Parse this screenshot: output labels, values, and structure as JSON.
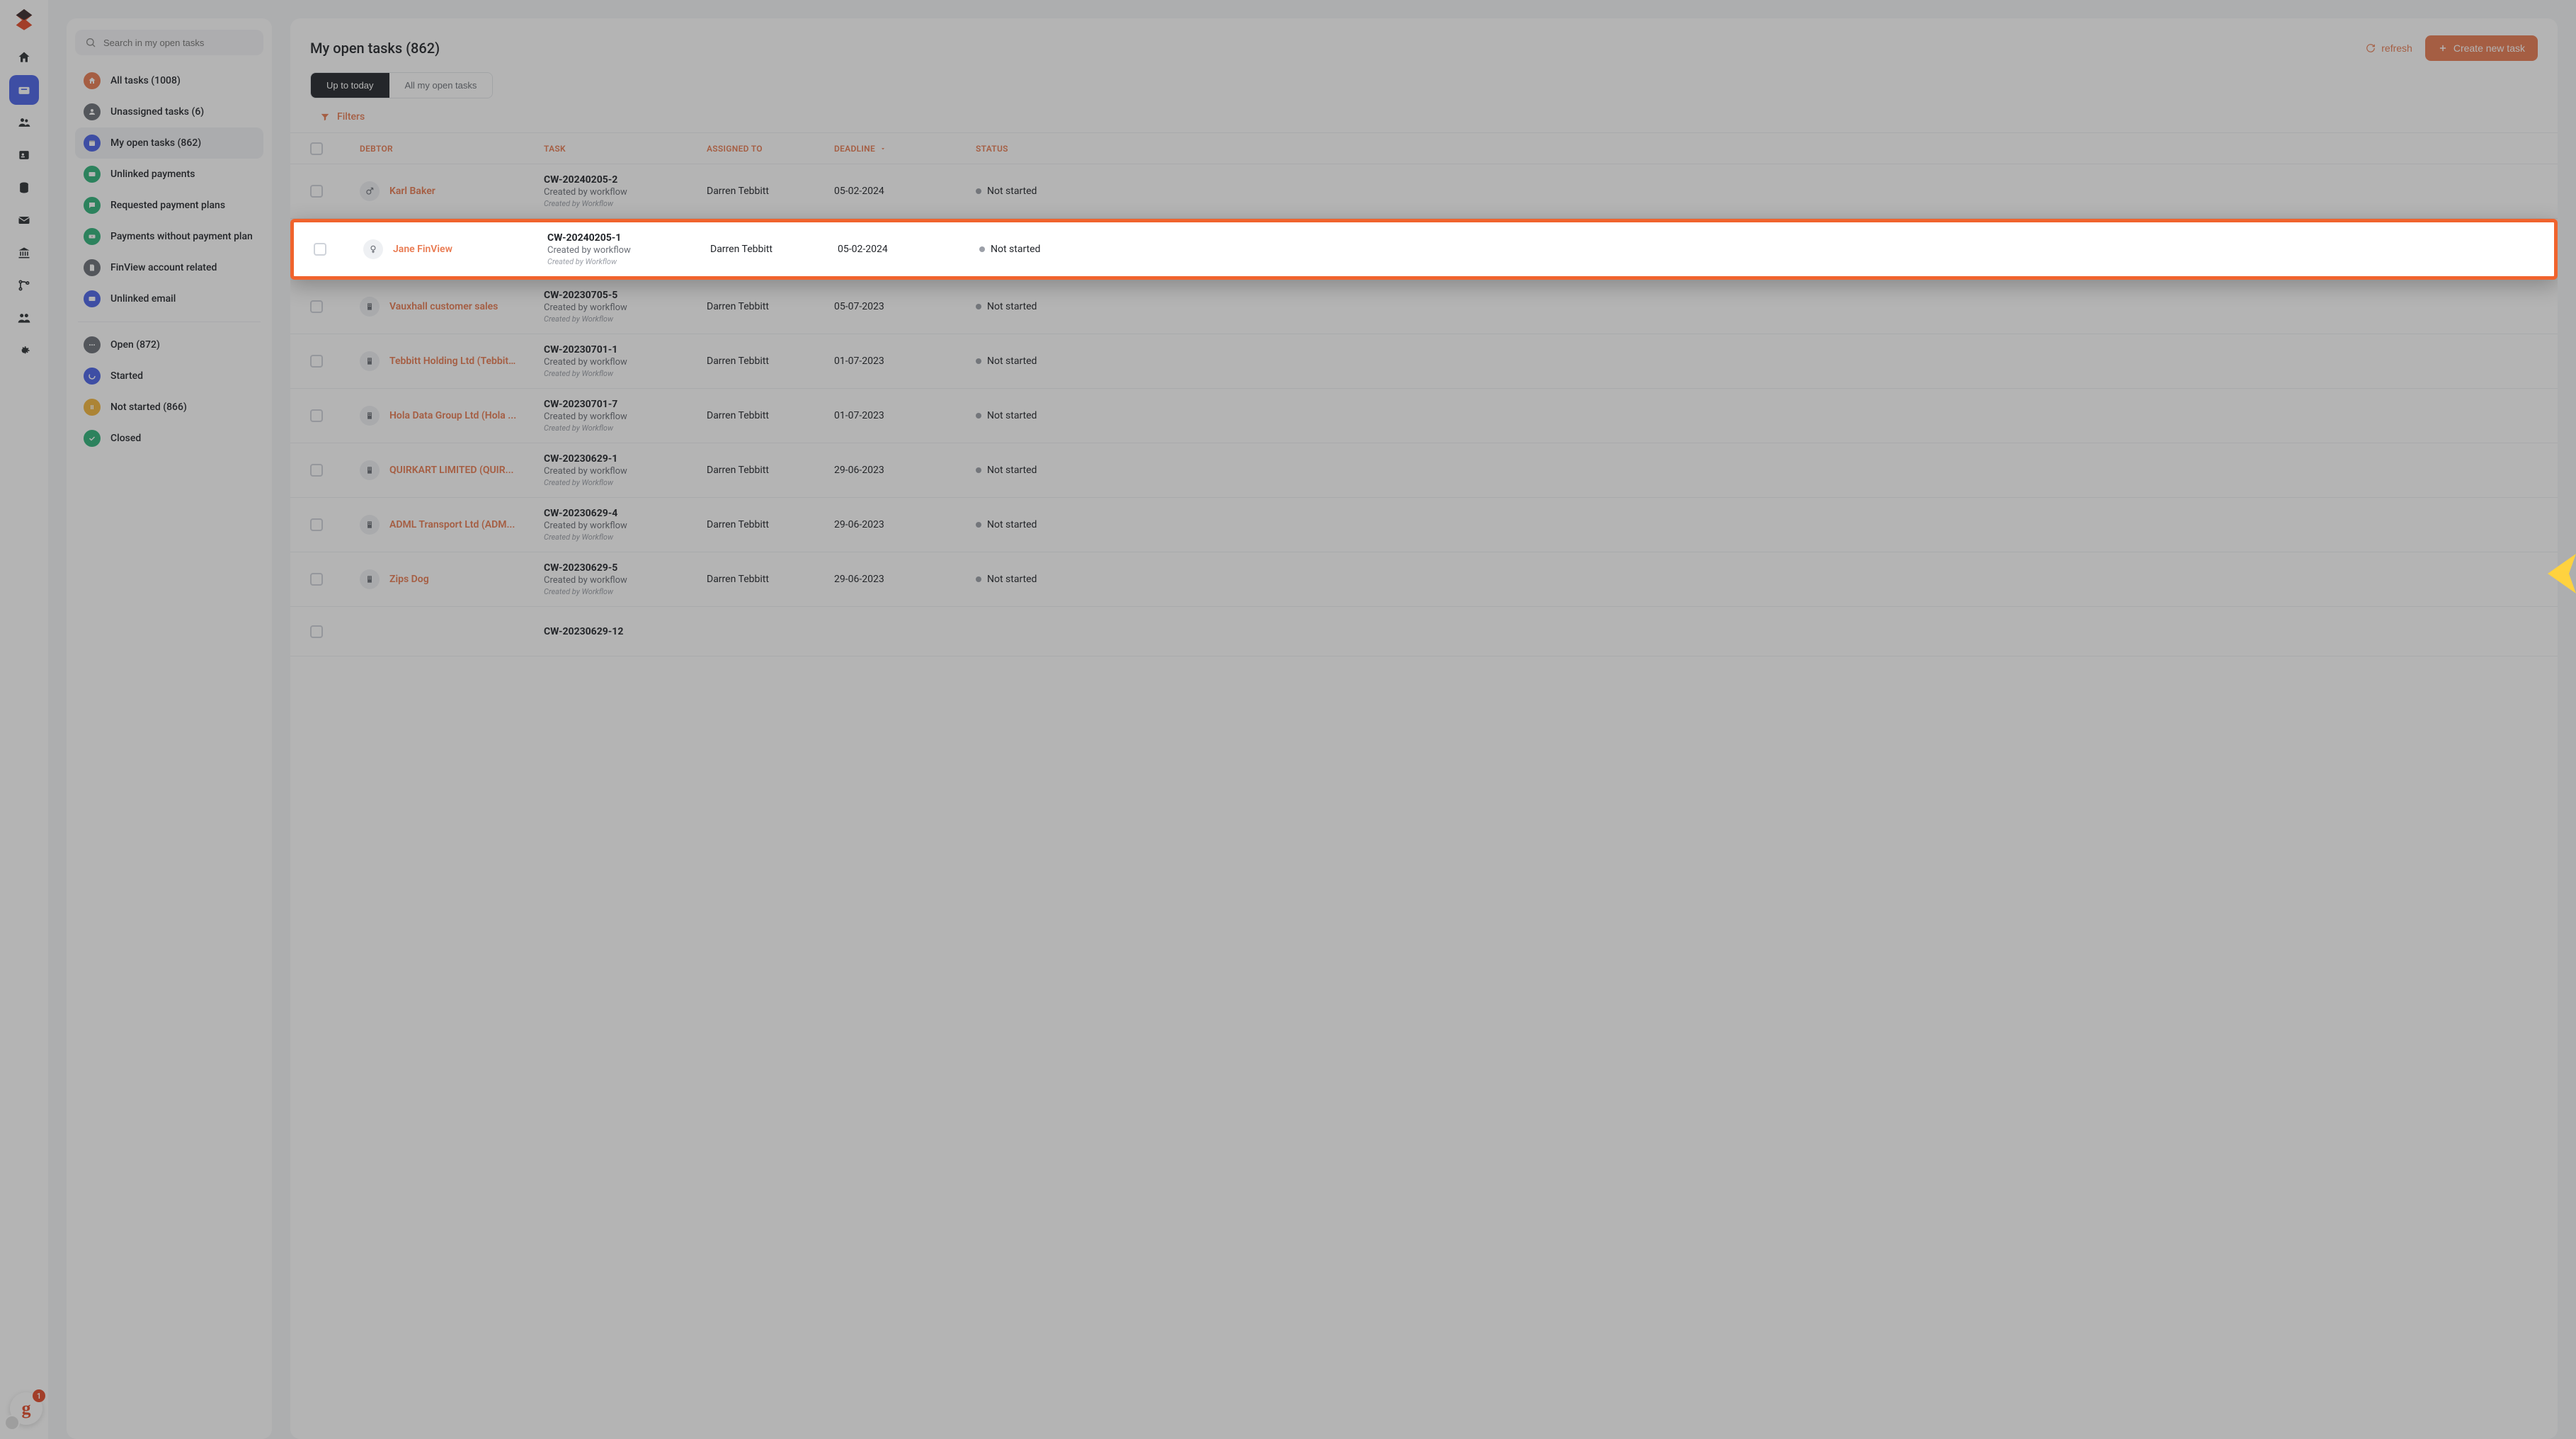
{
  "search": {
    "placeholder": "Search in my open tasks"
  },
  "sidebar": {
    "groups": [
      [
        {
          "label": "All tasks (1008)",
          "color": "#e97b52",
          "icon": "home"
        },
        {
          "label": "Unassigned tasks (6)",
          "color": "#6b6f77",
          "icon": "user"
        },
        {
          "label": "My open tasks (862)",
          "color": "#4b63e6",
          "icon": "calendar",
          "active": true
        },
        {
          "label": "Unlinked payments",
          "color": "#2fb37a",
          "icon": "card"
        },
        {
          "label": "Requested payment plans",
          "color": "#2fb37a",
          "icon": "chat"
        },
        {
          "label": "Payments without payment plan",
          "color": "#2fb37a",
          "icon": "money"
        },
        {
          "label": "FinView account related",
          "color": "#6b6f77",
          "icon": "doc"
        },
        {
          "label": "Unlinked email",
          "color": "#4b63e6",
          "icon": "mail"
        }
      ],
      [
        {
          "label": "Open (872)",
          "color": "#6b6f77",
          "icon": "dots"
        },
        {
          "label": "Started",
          "color": "#4b63e6",
          "icon": "spinner"
        },
        {
          "label": "Not started (866)",
          "color": "#f3b63c",
          "icon": "pause"
        },
        {
          "label": "Closed",
          "color": "#2fb37a",
          "icon": "check"
        }
      ]
    ]
  },
  "header": {
    "title": "My open tasks (862)",
    "refresh": "refresh",
    "create": "Create new task"
  },
  "tabs": {
    "up_to_today": "Up to today",
    "all_open": "All my open tasks"
  },
  "filters_label": "Filters",
  "columns": {
    "debtor": "DEBTOR",
    "task": "TASK",
    "assigned": "ASSIGNED TO",
    "deadline": "DEADLINE",
    "status": "STATUS"
  },
  "rows": [
    {
      "debtor": "Karl Baker",
      "icon": "male",
      "task_id": "CW-20240205-2",
      "sub": "Created by workflow",
      "meta": "Created by Workflow",
      "assigned": "Darren Tebbitt",
      "deadline": "05-02-2024",
      "status": "Not started",
      "highlight": false
    },
    {
      "debtor": "Jane FinView",
      "icon": "female",
      "task_id": "CW-20240205-1",
      "sub": "Created by workflow",
      "meta": "Created by Workflow",
      "assigned": "Darren Tebbitt",
      "deadline": "05-02-2024",
      "status": "Not started",
      "highlight": true
    },
    {
      "debtor": "Vauxhall customer sales",
      "icon": "building",
      "task_id": "CW-20230705-5",
      "sub": "Created by workflow",
      "meta": "Created by Workflow",
      "assigned": "Darren Tebbitt",
      "deadline": "05-07-2023",
      "status": "Not started",
      "highlight": false
    },
    {
      "debtor": "Tebbitt Holding Ltd (Tebbit...",
      "icon": "building",
      "task_id": "CW-20230701-1",
      "sub": "Created by workflow",
      "meta": "Created by Workflow",
      "assigned": "Darren Tebbitt",
      "deadline": "01-07-2023",
      "status": "Not started",
      "highlight": false
    },
    {
      "debtor": "Hola Data Group Ltd (Hola ...",
      "icon": "building",
      "task_id": "CW-20230701-7",
      "sub": "Created by workflow",
      "meta": "Created by Workflow",
      "assigned": "Darren Tebbitt",
      "deadline": "01-07-2023",
      "status": "Not started",
      "highlight": false
    },
    {
      "debtor": "QUIRKART LIMITED (QUIR...",
      "icon": "building",
      "task_id": "CW-20230629-1",
      "sub": "Created by workflow",
      "meta": "Created by Workflow",
      "assigned": "Darren Tebbitt",
      "deadline": "29-06-2023",
      "status": "Not started",
      "highlight": false
    },
    {
      "debtor": "ADML Transport Ltd (ADM...",
      "icon": "building",
      "task_id": "CW-20230629-4",
      "sub": "Created by workflow",
      "meta": "Created by Workflow",
      "assigned": "Darren Tebbitt",
      "deadline": "29-06-2023",
      "status": "Not started",
      "highlight": false
    },
    {
      "debtor": "Zips Dog",
      "icon": "building",
      "task_id": "CW-20230629-5",
      "sub": "Created by workflow",
      "meta": "Created by Workflow",
      "assigned": "Darren Tebbitt",
      "deadline": "29-06-2023",
      "status": "Not started",
      "highlight": false
    },
    {
      "debtor": "",
      "icon": "",
      "task_id": "CW-20230629-12",
      "sub": "",
      "meta": "",
      "assigned": "",
      "deadline": "",
      "status": "",
      "highlight": false
    }
  ],
  "avatar_badge": {
    "count": "1",
    "letter": "g"
  }
}
